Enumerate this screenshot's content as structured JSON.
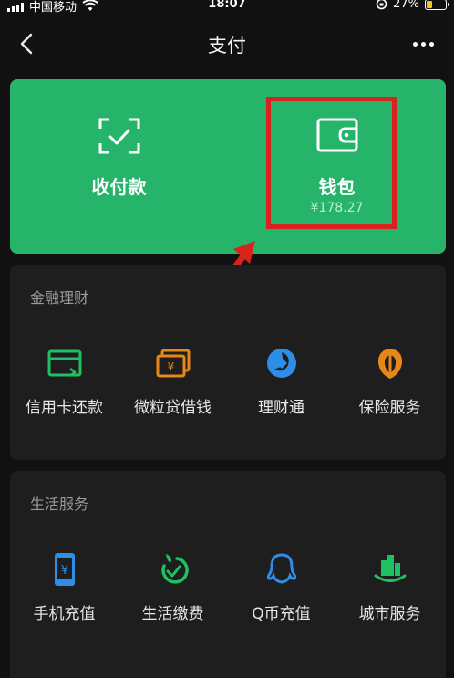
{
  "status_bar": {
    "carrier": "中国移动",
    "time": "18:07",
    "battery": "27%"
  },
  "nav": {
    "title": "支付"
  },
  "hero": {
    "receive_pay_label": "收付款",
    "wallet_label": "钱包",
    "wallet_balance": "¥178.27"
  },
  "finance": {
    "heading": "金融理财",
    "items": [
      {
        "label": "信用卡还款",
        "icon": "credit-card-icon"
      },
      {
        "label": "微粒贷借钱",
        "icon": "loan-icon"
      },
      {
        "label": "理财通",
        "icon": "wealth-icon"
      },
      {
        "label": "保险服务",
        "icon": "insurance-icon"
      }
    ]
  },
  "life": {
    "heading": "生活服务",
    "items": [
      {
        "label": "手机充值",
        "icon": "phone-topup-icon"
      },
      {
        "label": "生活缴费",
        "icon": "utility-bill-icon"
      },
      {
        "label": "Q币充值",
        "icon": "qq-coin-icon"
      },
      {
        "label": "城市服务",
        "icon": "city-service-icon"
      }
    ]
  },
  "colors": {
    "hero_green": "#26b46a",
    "highlight_red": "#d7231d",
    "card_bg": "#1e1e1e",
    "page_bg": "#111111",
    "icon_green": "#1fbf63",
    "icon_orange": "#e8861a",
    "icon_blue": "#2e8de6"
  }
}
